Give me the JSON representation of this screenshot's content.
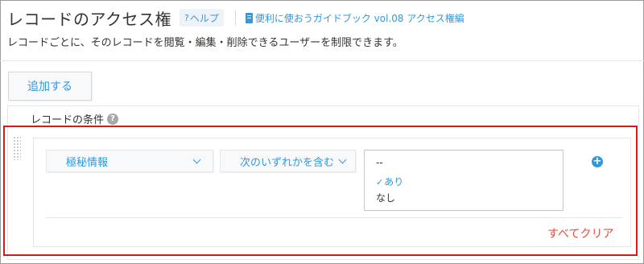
{
  "header": {
    "title": "レコードのアクセス権",
    "help_prefix": "?",
    "help_label": "ヘルプ",
    "guide_link": "便利に使おうガイドブック vol.08 アクセス権編"
  },
  "description": "レコードごとに、そのレコードを閲覧・編集・削除できるユーザーを制限できます。",
  "add_button": "追加する",
  "record_condition": {
    "label": "レコードの条件",
    "help_icon": "?",
    "field_select": "極秘情報",
    "operator_select": "次のいずれかを含む",
    "options": [
      {
        "label": "--",
        "checked": false
      },
      {
        "label": "あり",
        "checked": true
      },
      {
        "label": "なし",
        "checked": false
      }
    ],
    "check_glyph": "✓",
    "add_icon": "+",
    "clear_all": "すべてクリア"
  },
  "colors": {
    "accent": "#3498db",
    "highlight_border": "#d31c1c",
    "clear_link": "#e74c3c"
  }
}
